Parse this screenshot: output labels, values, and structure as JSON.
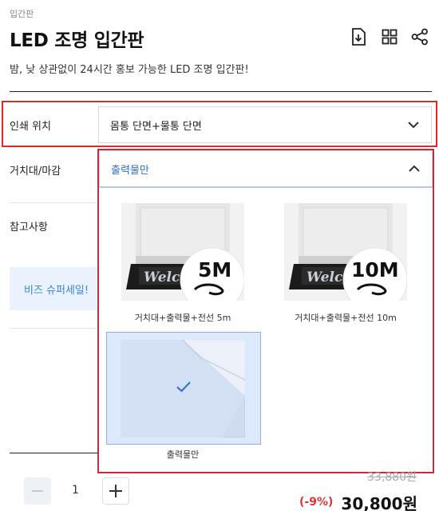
{
  "header": {
    "breadcrumb": "입간판",
    "title": "LED 조명 입간판",
    "subtitle": "밤, 낮 상관없이 24시간 홍보 가능한 LED 조명 입간판!",
    "icons": [
      "download-icon",
      "grid-icon",
      "share-icon"
    ]
  },
  "options": {
    "print_position": {
      "label": "인쇄 위치",
      "value": "몸통 단면+물통 단면"
    },
    "stand": {
      "label": "거치대/마감",
      "value": "출력물만",
      "choices": [
        {
          "label": "거치대+출력물+전선 5m",
          "badge": "5M",
          "image_text": "Welc"
        },
        {
          "label": "거치대+출력물+전선 10m",
          "badge": "10M",
          "image_text": "Welc"
        },
        {
          "label": "출력물만"
        }
      ],
      "selected_index": 2
    },
    "notes": {
      "label": "참고사항"
    }
  },
  "banner": {
    "text": "비즈 슈퍼세일!"
  },
  "purchase": {
    "quantity": "1",
    "original_price": "33,880원",
    "discount": "(-9%)",
    "final_price": "30,800원"
  },
  "colors": {
    "accent_blue": "#2f6fc9",
    "highlight_red": "#d32d2d",
    "discount_red": "#e0323a",
    "selected_bg": "#dce8fb"
  }
}
